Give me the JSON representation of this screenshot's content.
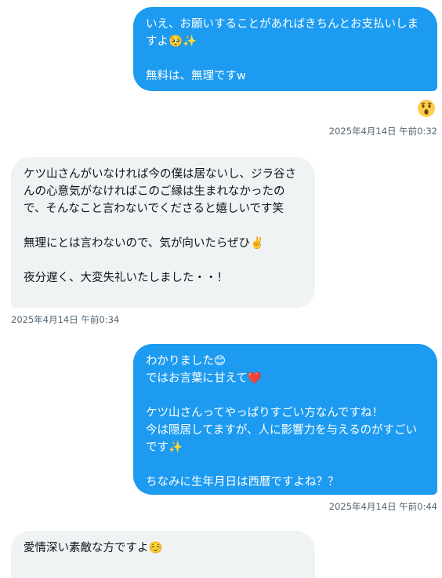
{
  "messages": [
    {
      "direction": "outgoing",
      "text": "いえ、お願いすることがあればきちんとお支払いしますよ🥺✨\n\n無料は、無理ですw",
      "reaction": "😲",
      "timestamp": "2025年4月14日 午前0:32"
    },
    {
      "direction": "incoming",
      "text": "ケツ山さんがいなければ今の僕は居ないし、ジラ谷さんの心意気がなければこのご縁は生まれなかったので、そんなこと言わないでくださると嬉しいです笑\n\n無理にとは言わないので、気が向いたらぜひ✌️\n\n夜分遅く、大変失礼いたしました・・！",
      "timestamp": "2025年4月14日 午前0:34"
    },
    {
      "direction": "outgoing",
      "text": "わかりました😊\nではお言葉に甘えて❤️\n\nケツ山さんってやっぱりすごい方なんですね！\n今は隠居してますが、人に影響力を与えるのがすごいです✨\n\nちなみに生年月日は西暦ですよね？？",
      "timestamp": "2025年4月14日 午前0:44"
    },
    {
      "direction": "incoming",
      "text": "愛情深い素敵な方ですよ☺️"
    }
  ],
  "colors": {
    "outgoing_bubble": "#1d9bf0",
    "incoming_bubble": "#eff3f4",
    "timestamp": "#536471"
  }
}
